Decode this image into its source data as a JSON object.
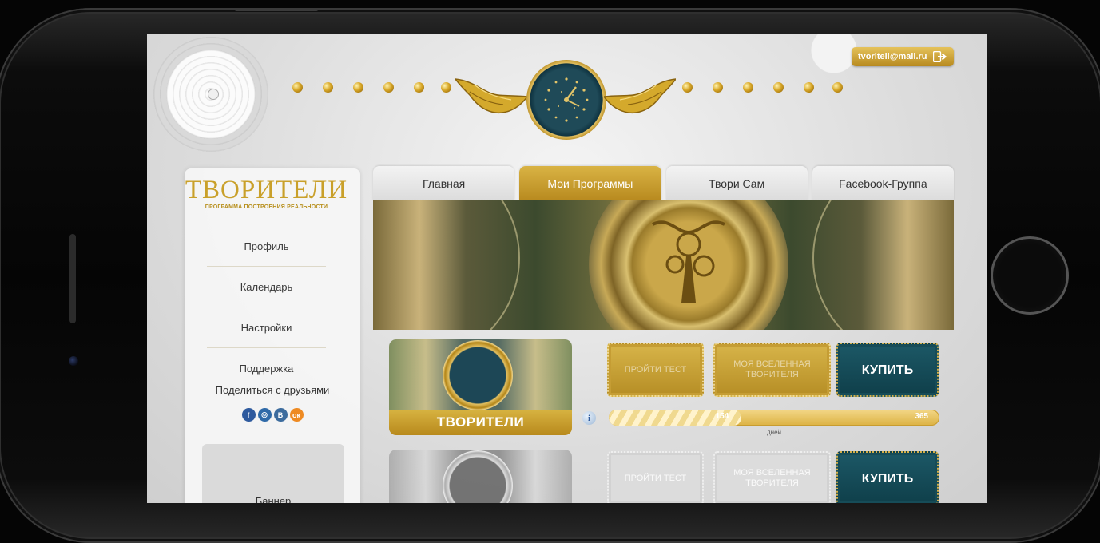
{
  "header": {
    "email": "tvoriteli@mail.ru"
  },
  "brand": {
    "title": "ТВОРИТЕЛИ",
    "subtitle": "ПРОГРАММА ПОСТРОЕНИЯ РЕАЛЬНОСТИ"
  },
  "sidebar": {
    "items": [
      {
        "label": "Профиль"
      },
      {
        "label": "Календарь"
      },
      {
        "label": "Настройки"
      },
      {
        "label": "Поддержка"
      }
    ],
    "share_label": "Поделиться с друзьями",
    "social": [
      {
        "name": "facebook-icon",
        "glyph": "f"
      },
      {
        "name": "instagram-icon",
        "glyph": "◎"
      },
      {
        "name": "vk-icon",
        "glyph": "В"
      },
      {
        "name": "odnoklassniki-icon",
        "glyph": "ок"
      }
    ],
    "banner_label": "Баннер"
  },
  "tabs": [
    {
      "label": "Главная",
      "active": false
    },
    {
      "label": "Мои Программы",
      "active": true
    },
    {
      "label": "Твори Сам",
      "active": false
    },
    {
      "label": "Facebook-Группа",
      "active": false
    }
  ],
  "programs": [
    {
      "label": "ТВОРИТЕЛИ",
      "btn_test": "ПРОЙТИ ТЕСТ",
      "btn_universe": "МОЯ ВСЕЛЕННАЯ ТВОРИТЕЛЯ",
      "btn_buy": "КУПИТЬ",
      "progress_current": "154",
      "progress_total": "365",
      "progress_fraction": 0.4,
      "progress_unit": "дней"
    },
    {
      "btn_test": "ПРОЙТИ ТЕСТ",
      "btn_universe": "МОЯ ВСЕЛЕННАЯ ТВОРИТЕЛЯ",
      "btn_buy": "КУПИТЬ"
    }
  ],
  "colors": {
    "gold": "#c9a02a",
    "teal": "#0f3f4a"
  }
}
